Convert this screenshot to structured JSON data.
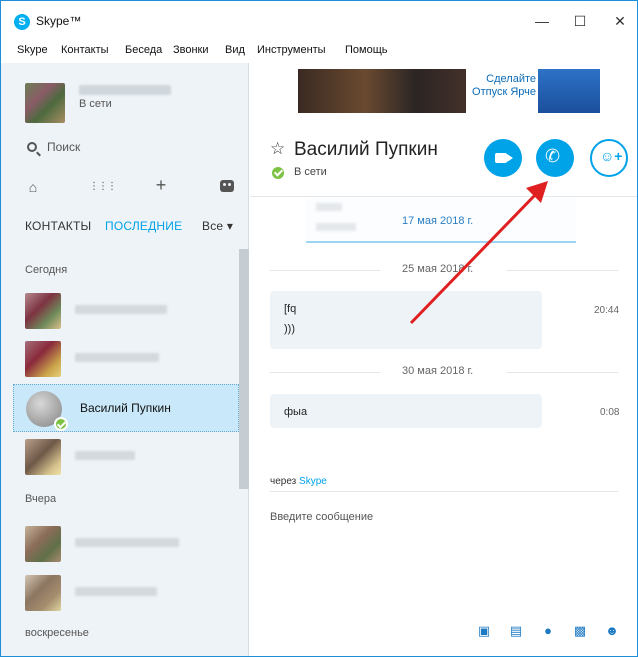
{
  "window": {
    "title": "Skype™",
    "logo_letter": "S",
    "minimize_glyph": "—",
    "maximize_glyph": "☐",
    "close_glyph": "✕"
  },
  "menu": [
    "Skype",
    "Контакты",
    "Беседа",
    "Звонки",
    "Вид",
    "Инструменты",
    "Помощь"
  ],
  "sidebar": {
    "profile_status": "В сети",
    "search_label": "Поиск",
    "icons": [
      "home-icon",
      "dialpad-icon",
      "plus-icon",
      "bot-icon"
    ],
    "tabs": {
      "contacts": "КОНТАКТЫ",
      "recent": "ПОСЛЕДНИЕ",
      "filter": "Все"
    },
    "sections": {
      "today": "Сегодня",
      "yesterday": "Вчера",
      "sunday": "воскресенье"
    },
    "selected_contact": "Василий Пупкин"
  },
  "ad": {
    "text": "Сделайте Отпуск Ярче"
  },
  "conversation": {
    "title": "Василий Пупкин",
    "status": "В сети",
    "buttons": [
      "video-call",
      "voice-call",
      "add-participant"
    ],
    "prev_date": "17 мая 2018 г.",
    "messages": [
      {
        "date": "25 мая 2018 г.",
        "lines": [
          "[fq",
          ")))"
        ],
        "time": "20:44"
      },
      {
        "date": "30 мая 2018 г.",
        "lines": [
          "фыа"
        ],
        "time": "0:08"
      }
    ],
    "via_prefix": "через",
    "via_service": "Skype",
    "compose_placeholder": "Введите сообщение"
  },
  "bottom_toolbar": [
    "media-icon",
    "file-icon",
    "video-message-icon",
    "contact-card-icon",
    "emoticon-icon"
  ],
  "colors": {
    "accent": "#00a2e8",
    "online": "#7cc243",
    "selected": "#c9e8fa",
    "arrow": "#e02020"
  }
}
